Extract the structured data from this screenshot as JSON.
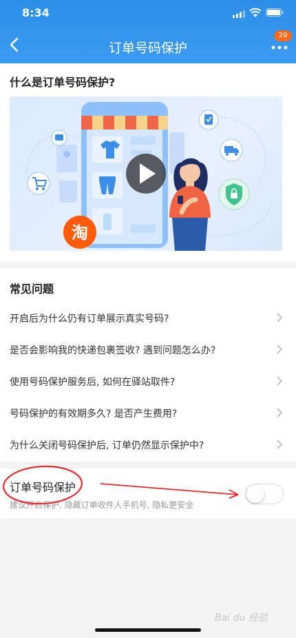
{
  "status": {
    "time": "8:34"
  },
  "nav": {
    "title": "订单号码保护",
    "badge": "29"
  },
  "intro": {
    "title": "什么是订单号码保护?",
    "taobao_char": "淘"
  },
  "faq": {
    "title": "常见问题",
    "items": [
      "开启后为什么仍有订单展示真实号码?",
      "是否会影响我的快递包裹签收? 遇到问题怎么办?",
      "使用号码保护服务后, 如何在驿站取件?",
      "号码保护的有效期多久? 是否产生费用?",
      "为什么关闭号码保护后, 订单仍然显示保护中?"
    ]
  },
  "protect": {
    "title": "订单号码保护",
    "desc": "建议开启保护, 隐藏订单收件人手机号, 隐私更安全",
    "enabled": false
  },
  "annotation_color": "#e8272f",
  "watermark": "Bai du 经验"
}
